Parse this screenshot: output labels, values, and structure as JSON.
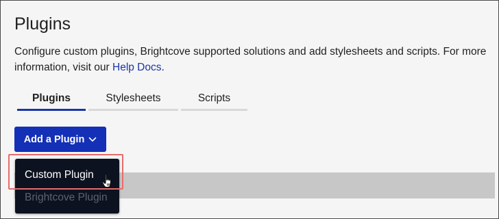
{
  "page": {
    "title": "Plugins",
    "description_text": "Configure custom plugins, Brightcove supported solutions and add stylesheets and scripts. For more information, visit our ",
    "help_link": "Help Docs",
    "description_end": "."
  },
  "tabs": [
    {
      "label": "Plugins",
      "active": true
    },
    {
      "label": "Stylesheets",
      "active": false
    },
    {
      "label": "Scripts",
      "active": false
    }
  ],
  "add_button": {
    "label": "Add a Plugin",
    "icon": "chevron-down-icon"
  },
  "dropdown": {
    "items": [
      {
        "label": "Custom Plugin",
        "highlighted": true
      },
      {
        "label": "Brightcove Plugin",
        "highlighted": false
      }
    ]
  },
  "colors": {
    "accent": "#1430b7",
    "link": "#1a35a6",
    "highlight_box": "#e86b6b",
    "menu_bg": "#0d1220"
  }
}
